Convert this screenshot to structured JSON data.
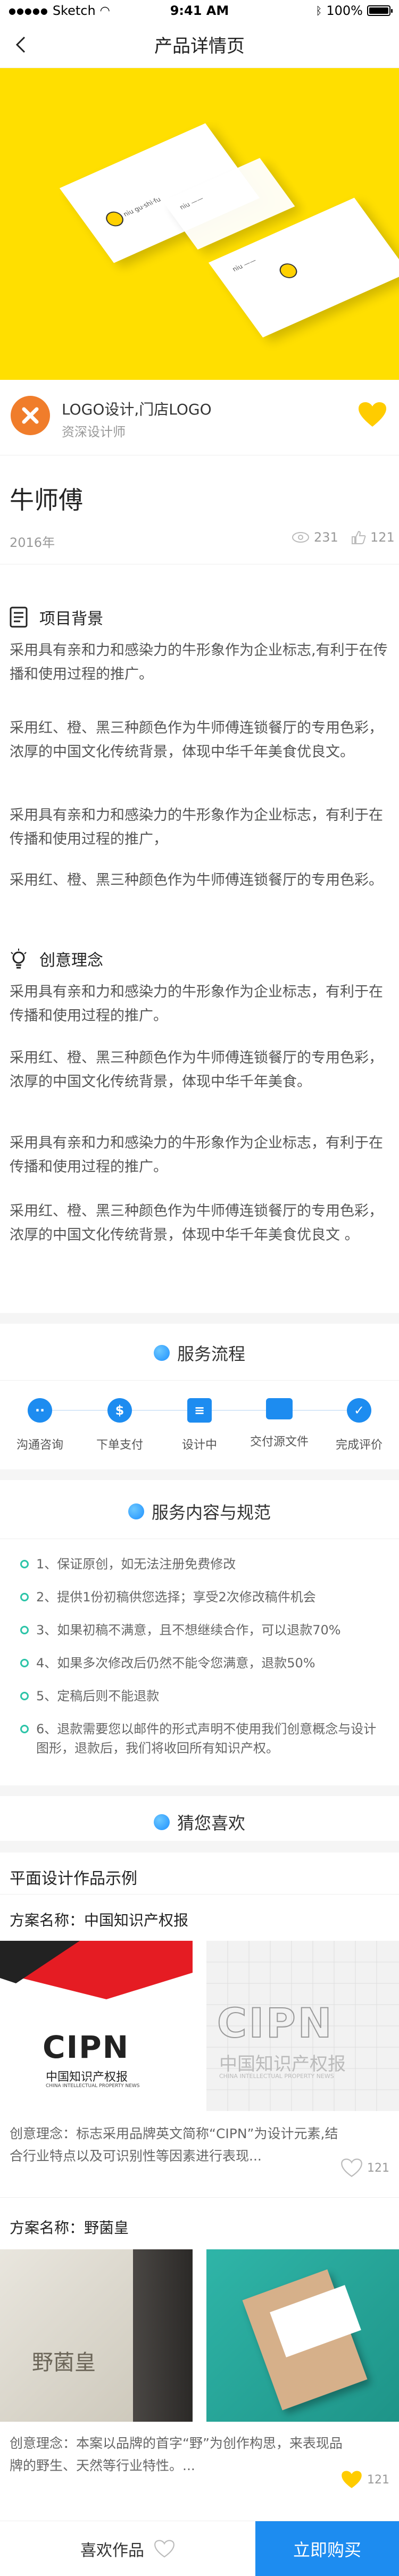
{
  "status": {
    "carrier": "Sketch",
    "time": "9:41 AM",
    "battery": "100%"
  },
  "nav": {
    "title": "产品详情页"
  },
  "designer": {
    "name": "LOGO设计,门店LOGO",
    "role": "资深设计师",
    "avatar_icon": "close-x-icon",
    "favorite_icon": "heart-icon"
  },
  "product": {
    "title": "牛师傅",
    "year": "2016年",
    "views": "231",
    "likes": "121"
  },
  "background": {
    "title": "项目背景",
    "paragraphs": [
      "采用具有亲和力和感染力的牛形象作为企业标志,有利于在传播和使用过程的推广。",
      "采用红、橙、黑三种颜色作为牛师傅连锁餐厅的专用色彩，浓厚的中国文化传统背景，体现中华千年美食优良文。",
      "采用具有亲和力和感染力的牛形象作为企业标志，有利于在传播和使用过程的推广，",
      "采用红、橙、黑三种颜色作为牛师傅连锁餐厅的专用色彩。"
    ]
  },
  "concept": {
    "title": "创意理念",
    "paragraphs": [
      "采用具有亲和力和感染力的牛形象作为企业标志，有利于在传播和使用过程的推广。",
      "采用红、橙、黑三种颜色作为牛师傅连锁餐厅的专用色彩，浓厚的中国文化传统背景，体现中华千年美食。",
      "采用具有亲和力和感染力的牛形象作为企业标志，有利于在传播和使用过程的推广。",
      "采用红、橙、黑三种颜色作为牛师傅连锁餐厅的专用色彩，浓厚的中国文化传统背景，体现中华千年美食优良文 。"
    ]
  },
  "flow": {
    "title": "服务流程",
    "steps": [
      "沟通咨询",
      "下单支付",
      "设计中",
      "交付源文件",
      "完成评价"
    ]
  },
  "service": {
    "title": "服务内容与规范",
    "items": [
      "1、保证原创，如无法注册免费修改",
      "2、提供1份初稿供您选择；享受2次修改稿件机会",
      "3、如果初稿不满意，且不想继续合作，可以退款70%",
      "4、如果多次修改后仍然不能令您满意，退款50%",
      "5、定稿后则不能退款",
      "6、退款需要您以邮件的形式声明不使用我们创意概念与设计图形，退款后，我们将收回所有知识产权。"
    ]
  },
  "guess": {
    "title": "猜您喜欢",
    "section": "平面设计作品示例",
    "cases": [
      {
        "name": "方案名称：中国知识产权报",
        "desc": "创意理念：标志采用品牌英文简称“CIPN”为设计元素,结合行业特点以及可识别性等因素进行表现...",
        "likes": "121",
        "logo_text": "CIPN",
        "logo_sub": "中国知识产权报",
        "logo_en": "CHINA INTELLECTUAL PROPERTY NEWS"
      },
      {
        "name": "方案名称：野菌皇",
        "desc": "创意理念：本案以品牌的首字“野”为创作构思，来表现品牌的野生、天然等行业特性。...",
        "likes": "121",
        "logo_text": "野菌皇"
      }
    ]
  },
  "bottom": {
    "fav_label": "喜欢作品",
    "buy_label": "立即购买"
  },
  "colors": {
    "brand": "#1d8cf0",
    "yellow": "#ffdf00",
    "accent_green": "#2cc4a8",
    "orange": "#f07d2b"
  }
}
